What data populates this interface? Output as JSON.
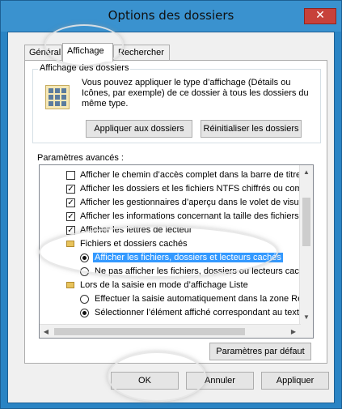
{
  "window": {
    "title": "Options des dossiers",
    "close_glyph": "✕"
  },
  "tabs": [
    {
      "label": "Général"
    },
    {
      "label": "Affichage",
      "active": true
    },
    {
      "label": "Rechercher"
    }
  ],
  "view_group": {
    "title": "Affichage des dossiers",
    "description": "Vous pouvez appliquer le type d’affichage (Détails ou Icônes, par exemple) de ce dossier à tous les dossiers du même type.",
    "apply_label": "Appliquer aux dossiers",
    "reset_label": "Réinitialiser les dossiers"
  },
  "advanced": {
    "label": "Paramètres avancés :",
    "items": [
      {
        "type": "checkbox",
        "checked": false,
        "label": "Afficher le chemin d’accès complet dans la barre de titre"
      },
      {
        "type": "checkbox",
        "checked": true,
        "label": "Afficher les dossiers et les fichiers NTFS chiffrés ou comp"
      },
      {
        "type": "checkbox",
        "checked": true,
        "label": "Afficher les gestionnaires d’aperçu dans le volet de visual"
      },
      {
        "type": "checkbox",
        "checked": true,
        "label": "Afficher les informations concernant la taille des fichiers d"
      },
      {
        "type": "checkbox",
        "checked": true,
        "label": "Afficher les lettres de lecteur"
      },
      {
        "type": "folder",
        "label": "Fichiers et dossiers cachés"
      },
      {
        "type": "radio",
        "selected": true,
        "label": "Afficher les fichiers, dossiers et lecteurs cachés"
      },
      {
        "type": "radio",
        "selected": false,
        "label": "Ne pas afficher les fichiers, dossiers ou lecteurs cach"
      },
      {
        "type": "folder",
        "label": "Lors de la saisie en mode d’affichage Liste"
      },
      {
        "type": "radio",
        "selected": false,
        "label": "Effectuer la saisie automatiquement dans la zone Rec"
      },
      {
        "type": "radio",
        "selected": true,
        "label": "Sélectionner l’élément affiché correspondant au texte"
      }
    ],
    "defaults_label": "Paramètres par défaut"
  },
  "footer": {
    "ok_label": "OK",
    "cancel_label": "Annuler",
    "apply_label": "Appliquer"
  },
  "colors": {
    "title_bar": "#3a92cf",
    "close_button": "#c7413a",
    "selection": "#3399ff"
  }
}
